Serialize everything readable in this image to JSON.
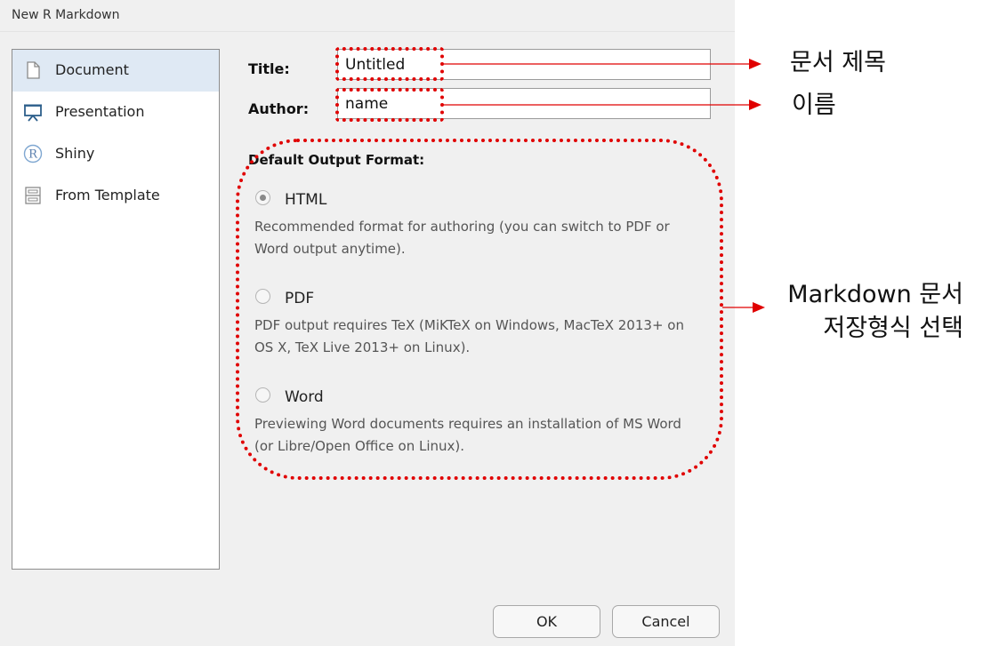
{
  "window": {
    "title": "New R Markdown"
  },
  "sidebar": {
    "items": [
      {
        "label": "Document",
        "icon": "document-icon",
        "selected": true
      },
      {
        "label": "Presentation",
        "icon": "presentation-icon",
        "selected": false
      },
      {
        "label": "Shiny",
        "icon": "r-logo-icon",
        "selected": false
      },
      {
        "label": "From Template",
        "icon": "template-icon",
        "selected": false
      }
    ]
  },
  "form": {
    "title_label": "Title:",
    "title_value": "Untitled",
    "author_label": "Author:",
    "author_value": "name"
  },
  "output_format": {
    "heading": "Default Output Format:",
    "options": [
      {
        "label": "HTML",
        "selected": true,
        "description": "Recommended format for authoring (you can switch to PDF or Word output anytime)."
      },
      {
        "label": "PDF",
        "selected": false,
        "description": "PDF output requires TeX (MiKTeX on Windows, MacTeX 2013+ on OS X, TeX Live 2013+ on Linux)."
      },
      {
        "label": "Word",
        "selected": false,
        "description": "Previewing Word documents requires an installation of MS Word (or Libre/Open Office on Linux)."
      }
    ]
  },
  "buttons": {
    "ok": "OK",
    "cancel": "Cancel"
  },
  "annotations": {
    "title_note": "문서 제목",
    "author_note": "이름",
    "format_note_line1": "Markdown 문서",
    "format_note_line2": "저장형식 선택",
    "color": "#e00000"
  }
}
